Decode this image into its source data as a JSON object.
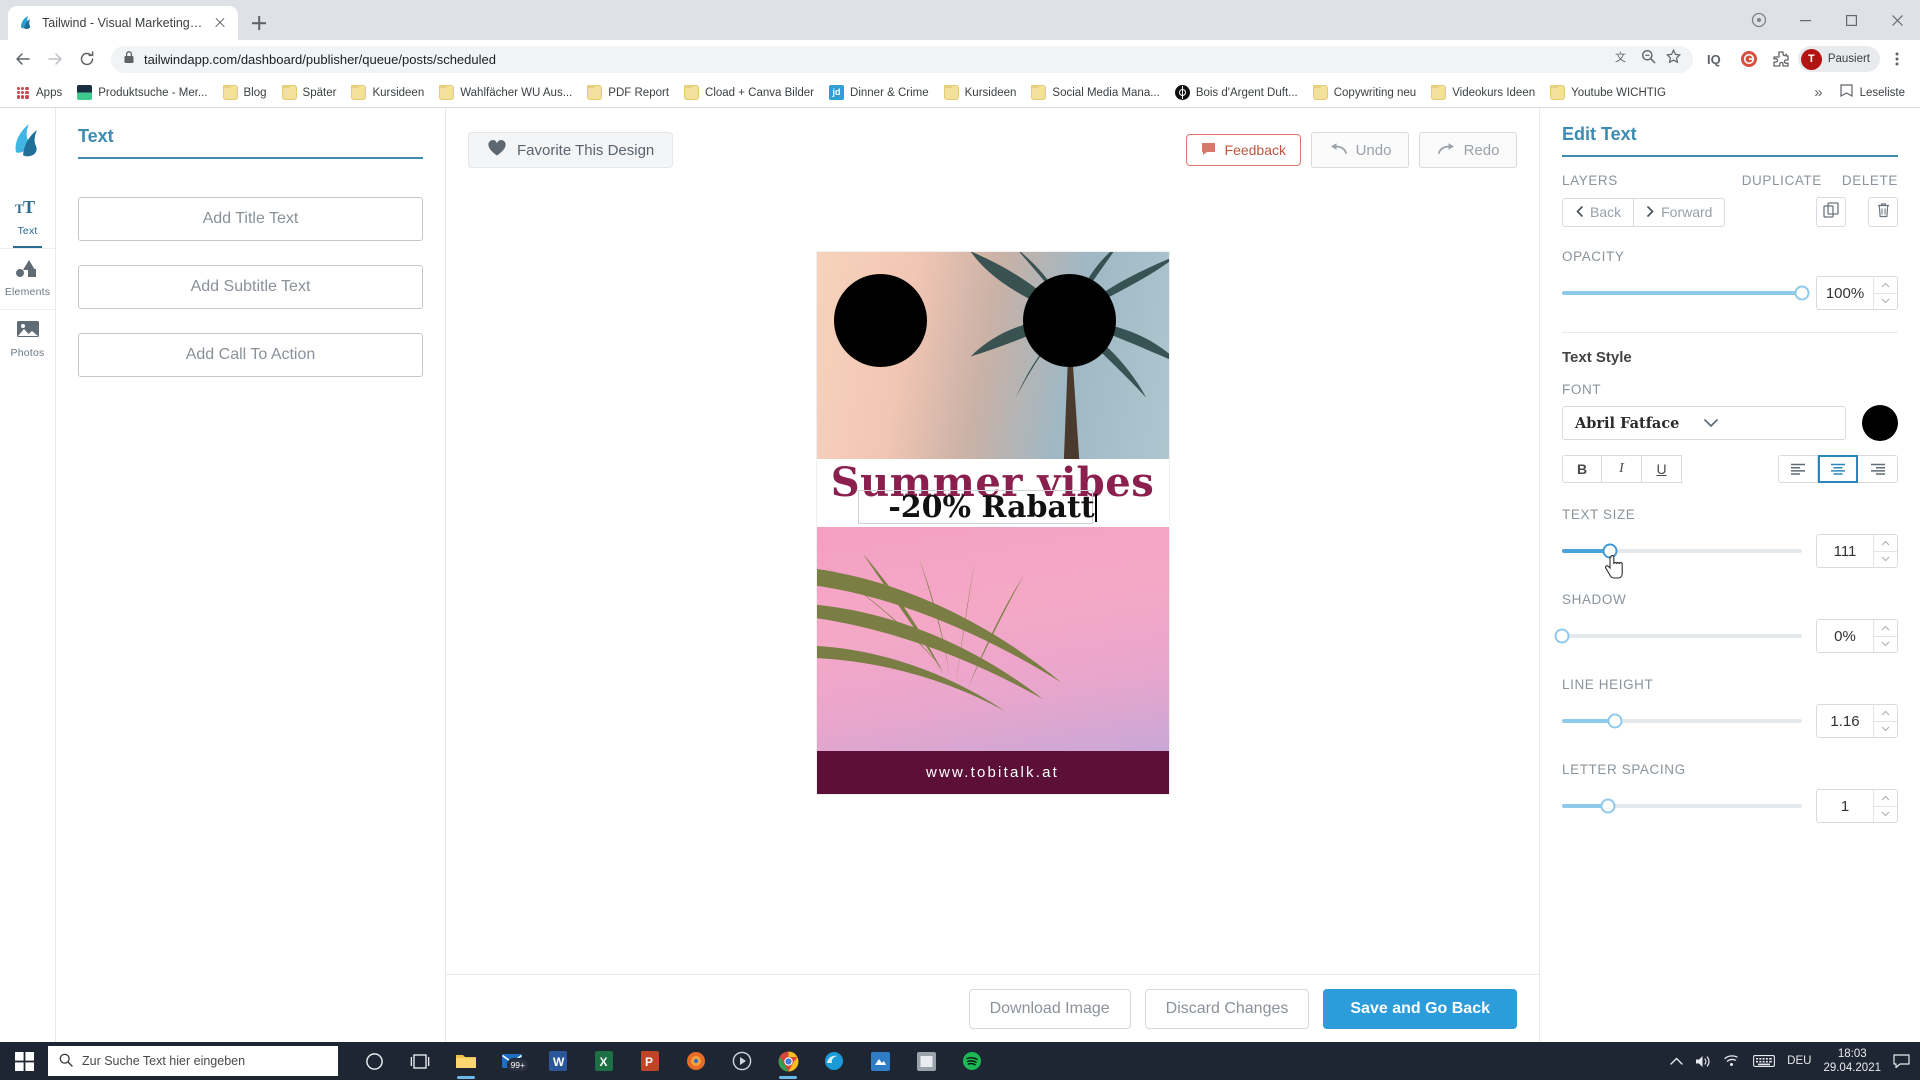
{
  "browser": {
    "tab": {
      "title": "Tailwind - Visual Marketing Suite",
      "favicon": "tailwind-logo-icon",
      "close": "close-icon"
    },
    "new_tab_label": "+",
    "url": "tailwindapp.com/dashboard/publisher/queue/posts/scheduled",
    "nav": {
      "back": "back-arrow-icon",
      "forward": "forward-arrow-icon",
      "reload": "reload-icon",
      "lock": "lock-icon"
    },
    "omni_right_icons": [
      "translate-icon",
      "zoom-icon",
      "star-icon"
    ],
    "toolbar_icons": [
      "iq-extension-icon",
      "grammarly-extension-icon",
      "extensions-puzzle-icon"
    ],
    "profile": {
      "initial": "T",
      "name": "Pausiert"
    },
    "menu_icon": "three-dot-menu-icon",
    "window_controls": [
      "minimize",
      "maximize",
      "close"
    ],
    "bookmarks": [
      {
        "label": "Apps",
        "icon": "apps-grid-icon"
      },
      {
        "label": "Produktsuche - Mer...",
        "icon": "site-icon"
      },
      {
        "label": "Blog",
        "icon": "folder-icon"
      },
      {
        "label": "Später",
        "icon": "folder-icon"
      },
      {
        "label": "Kursideen",
        "icon": "folder-icon"
      },
      {
        "label": "Wahlfächer WU Aus...",
        "icon": "folder-icon"
      },
      {
        "label": "PDF Report",
        "icon": "folder-icon"
      },
      {
        "label": "Cload + Canva Bilder",
        "icon": "folder-icon"
      },
      {
        "label": "Dinner & Crime",
        "icon": "jd-site-icon"
      },
      {
        "label": "Kursideen",
        "icon": "folder-icon"
      },
      {
        "label": "Social Media Mana...",
        "icon": "folder-icon"
      },
      {
        "label": "Bois d'Argent Duft...",
        "icon": "dark-site-icon"
      },
      {
        "label": "Copywriting neu",
        "icon": "folder-icon"
      },
      {
        "label": "Videokurs Ideen",
        "icon": "folder-icon"
      },
      {
        "label": "Youtube WICHTIG",
        "icon": "folder-icon"
      }
    ],
    "bookmarks_overflow": "»",
    "reading_list": "Leseliste"
  },
  "rail": {
    "logo": "tailwind-logo-icon",
    "items": [
      {
        "label": "Text",
        "icon": "text-tool-icon",
        "active": true
      },
      {
        "label": "Elements",
        "icon": "shapes-icon",
        "active": false
      },
      {
        "label": "Photos",
        "icon": "photo-icon",
        "active": false
      }
    ]
  },
  "left_panel": {
    "tab_title": "Text",
    "buttons": [
      "Add Title Text",
      "Add Subtitle Text",
      "Add Call To Action"
    ]
  },
  "canvas_toolbar": {
    "favorite_label": "Favorite This Design",
    "favorite_icon": "heart-icon",
    "feedback_label": "Feedback",
    "feedback_icon": "speech-bubble-icon",
    "undo_label": "Undo",
    "undo_icon": "undo-arrow-icon",
    "redo_label": "Redo",
    "redo_icon": "redo-arrow-icon"
  },
  "design": {
    "title_text": "Summer vibes",
    "subtitle_text": "-20% Rabatt",
    "footer_text": "www.tobitalk.at",
    "title_color": "#8b1f4e",
    "subtitle_color": "#111111",
    "footer_bg": "#5c1038"
  },
  "canvas_footer": {
    "download": "Download Image",
    "discard": "Discard Changes",
    "save": "Save and Go Back",
    "save_color": "#2d9cdb"
  },
  "right_panel": {
    "title": "Edit Text",
    "layers_label": "LAYERS",
    "duplicate_label": "DUPLICATE",
    "delete_label": "DELETE",
    "back_label": "Back",
    "forward_label": "Forward",
    "duplicate_icon": "duplicate-icon",
    "delete_icon": "trash-icon",
    "opacity_label": "OPACITY",
    "opacity_value": "100%",
    "opacity_percent": 100,
    "text_style_label": "Text Style",
    "font_label": "FONT",
    "font_value": "Abril Fatface",
    "font_color": "#000000",
    "bold_label": "B",
    "italic_label": "I",
    "underline_label": "U",
    "align_selected": "center",
    "text_size_label": "TEXT SIZE",
    "text_size_value": "111",
    "text_size_percent": 20,
    "shadow_label": "SHADOW",
    "shadow_value": "0%",
    "shadow_percent": 0,
    "line_height_label": "LINE HEIGHT",
    "line_height_value": "1.16",
    "line_height_percent": 22,
    "letter_spacing_label": "LETTER SPACING",
    "letter_spacing_value": "1",
    "letter_spacing_percent": 19
  },
  "taskbar": {
    "start_icon": "windows-start-icon",
    "search_placeholder": "Zur Suche Text hier eingeben",
    "search_icon": "search-icon",
    "items": [
      {
        "name": "cortana-icon",
        "badge": ""
      },
      {
        "name": "task-view-icon",
        "badge": ""
      },
      {
        "name": "file-explorer-icon",
        "badge": ""
      },
      {
        "name": "mail-icon",
        "badge": "99+"
      },
      {
        "name": "word-icon",
        "badge": ""
      },
      {
        "name": "excel-icon",
        "badge": ""
      },
      {
        "name": "powerpoint-icon",
        "badge": ""
      },
      {
        "name": "firefox-icon",
        "badge": ""
      },
      {
        "name": "media-icon",
        "badge": ""
      },
      {
        "name": "chrome-icon",
        "badge": ""
      },
      {
        "name": "edge-icon",
        "badge": ""
      },
      {
        "name": "app-blue-icon",
        "badge": ""
      },
      {
        "name": "app-grey-icon",
        "badge": ""
      },
      {
        "name": "spotify-icon",
        "badge": ""
      }
    ],
    "tray": {
      "chevron": "show-hidden-icons-icon",
      "volume": "volume-icon",
      "network": "wifi-icon",
      "keyboard": "keyboard-icon",
      "language": "DEU",
      "time": "18:03",
      "date": "29.04.2021",
      "notifications": "notification-icon"
    }
  }
}
